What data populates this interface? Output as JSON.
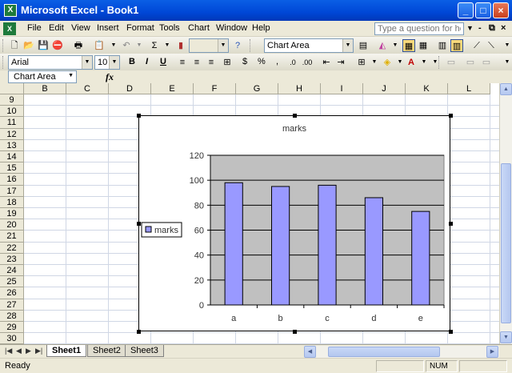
{
  "window": {
    "title": "Microsoft Excel - Book1",
    "app_icon": "X",
    "controls": [
      "_",
      "□",
      "×"
    ]
  },
  "menus": [
    "File",
    "Edit",
    "View",
    "Insert",
    "Format",
    "Tools",
    "Chart",
    "Window",
    "Help"
  ],
  "help": {
    "placeholder": "Type a question for help"
  },
  "mdi_controls": [
    "-",
    "⧉",
    "×"
  ],
  "toolbar1": {
    "chart_object": "Chart Area",
    "sum_symbol": "Σ"
  },
  "toolbar2": {
    "font": "Arial",
    "size": "10",
    "bold": "B",
    "italic": "I",
    "underline": "U",
    "currency": "$",
    "percent": "%",
    "comma": ","
  },
  "formula": {
    "namebox": "Chart Area",
    "fx": "fx"
  },
  "columns": [
    "B",
    "C",
    "D",
    "E",
    "F",
    "G",
    "H",
    "I",
    "J",
    "K",
    "L"
  ],
  "rows": [
    "9",
    "10",
    "11",
    "12",
    "13",
    "14",
    "15",
    "16",
    "17",
    "18",
    "19",
    "20",
    "21",
    "22",
    "23",
    "24",
    "25",
    "26",
    "27",
    "28",
    "29",
    "30"
  ],
  "sheets": [
    "Sheet1",
    "Sheet2",
    "Sheet3"
  ],
  "status": {
    "text": "Ready",
    "mode": "NUM"
  },
  "chart_data": {
    "type": "bar",
    "title": "marks",
    "categories": [
      "a",
      "b",
      "c",
      "d",
      "e"
    ],
    "series": [
      {
        "name": "marks",
        "values": [
          98,
          95,
          96,
          86,
          75
        ]
      }
    ],
    "ylim": [
      0,
      120
    ],
    "yticks": [
      0,
      20,
      40,
      60,
      80,
      100,
      120
    ],
    "grid": true,
    "legend": "left",
    "colors": {
      "bar": "#9999ff",
      "plot_area": "#c0c0c0"
    }
  }
}
